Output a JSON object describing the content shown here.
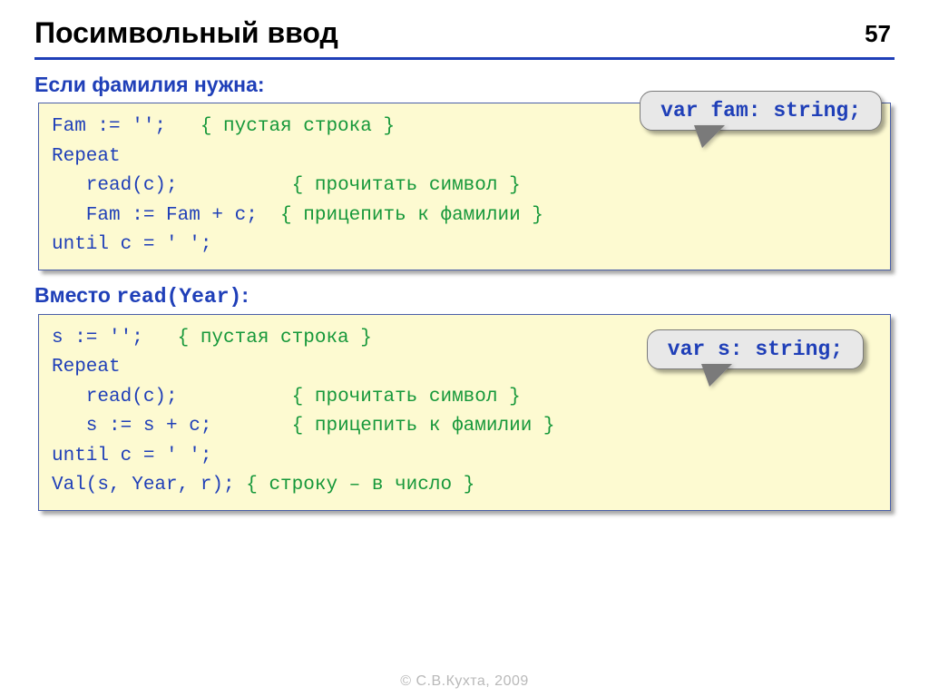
{
  "page_number": "57",
  "title": "Посимвольный ввод",
  "section1": {
    "heading": "Если фамилия нужна:",
    "callout": "var fam: string;",
    "code": {
      "l1a": "Fam := '';   ",
      "l1c": "{ пустая строка }",
      "l2": "Repeat",
      "l3a": "   read(c);          ",
      "l3c": "{ прочитать символ }",
      "l4a": "   Fam := Fam + c;  ",
      "l4c": "{ прицепить к фамилии }",
      "l5": "until c = ' ';"
    }
  },
  "section2": {
    "heading_pre": "Вместо ",
    "heading_mono": "read(Year)",
    "heading_post": ":",
    "callout": "var s: string;",
    "code": {
      "l1a": "s := '';   ",
      "l1c": "{ пустая строка }",
      "l2": "Repeat",
      "l3a": "   read(c);          ",
      "l3c": "{ прочитать символ }",
      "l4a": "   s := s + c;       ",
      "l4c": "{ прицепить к фамилии }",
      "l5": "until c = ' ';",
      "l6a": "Val(s, Year, r); ",
      "l6c": "{ строку – в число }"
    }
  },
  "footer": "© С.В.Кухта, 2009"
}
